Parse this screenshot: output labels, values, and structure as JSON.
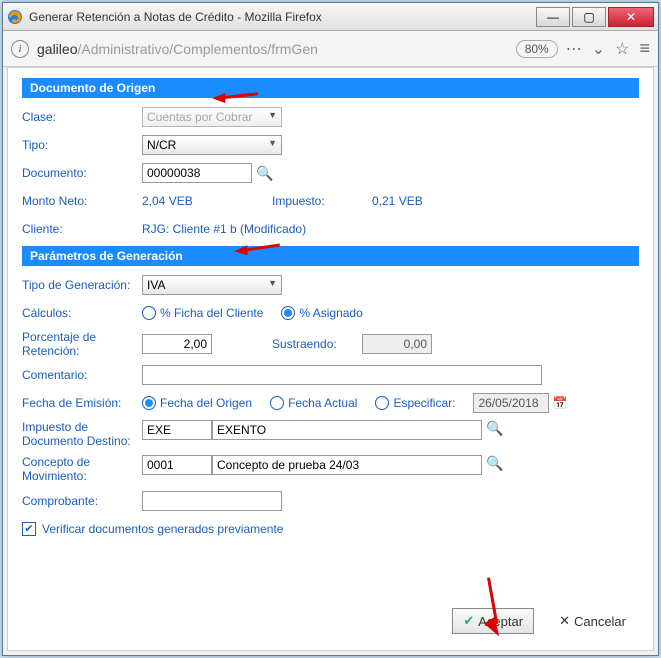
{
  "window": {
    "title": "Generar Retención a Notas de Crédito - Mozilla Firefox"
  },
  "addressbar": {
    "host": "galileo",
    "path": "/Administrativo/Complementos/frmGen",
    "zoom": "80%"
  },
  "sections": {
    "origen_title": "Documento de Origen",
    "params_title": "Parámetros de Generación"
  },
  "origen": {
    "clase_label": "Clase:",
    "clase_value": "Cuentas por Cobrar",
    "tipo_label": "Tipo:",
    "tipo_value": "N/CR",
    "doc_label": "Documento:",
    "doc_value": "00000038",
    "monto_label": "Monto Neto:",
    "monto_value": "2,04 VEB",
    "impuesto_label": "Impuesto:",
    "impuesto_value": "0,21 VEB",
    "cliente_label": "Cliente:",
    "cliente_value": "RJG: Cliente #1 b (Modificado)"
  },
  "params": {
    "tipogen_label": "Tipo de Generación:",
    "tipogen_value": "IVA",
    "calculos_label": "Cálculos:",
    "calc_ficha": "% Ficha del Cliente",
    "calc_asignado": "% Asignado",
    "pct_label": "Porcentaje de Retención:",
    "pct_value": "2,00",
    "sustraendo_label": "Sustraendo:",
    "sustraendo_value": "0,00",
    "comentario_label": "Comentario:",
    "comentario_value": "",
    "fecha_label": "Fecha de Emisión:",
    "fecha_origen": "Fecha del Origen",
    "fecha_actual": "Fecha Actual",
    "fecha_especificar": "Especificar:",
    "fecha_value": "26/05/2018",
    "impdoc_label": "Impuesto de Documento Destino:",
    "impdoc_code": "EXE",
    "impdoc_desc": "EXENTO",
    "concepto_label": "Concepto de Movimiento:",
    "concepto_code": "0001",
    "concepto_desc": "Concepto de prueba 24/03",
    "comprobante_label": "Comprobante:",
    "comprobante_value": "",
    "verificar_label": "Verificar documentos generados previamente"
  },
  "buttons": {
    "aceptar": "Aceptar",
    "cancelar": "Cancelar"
  }
}
